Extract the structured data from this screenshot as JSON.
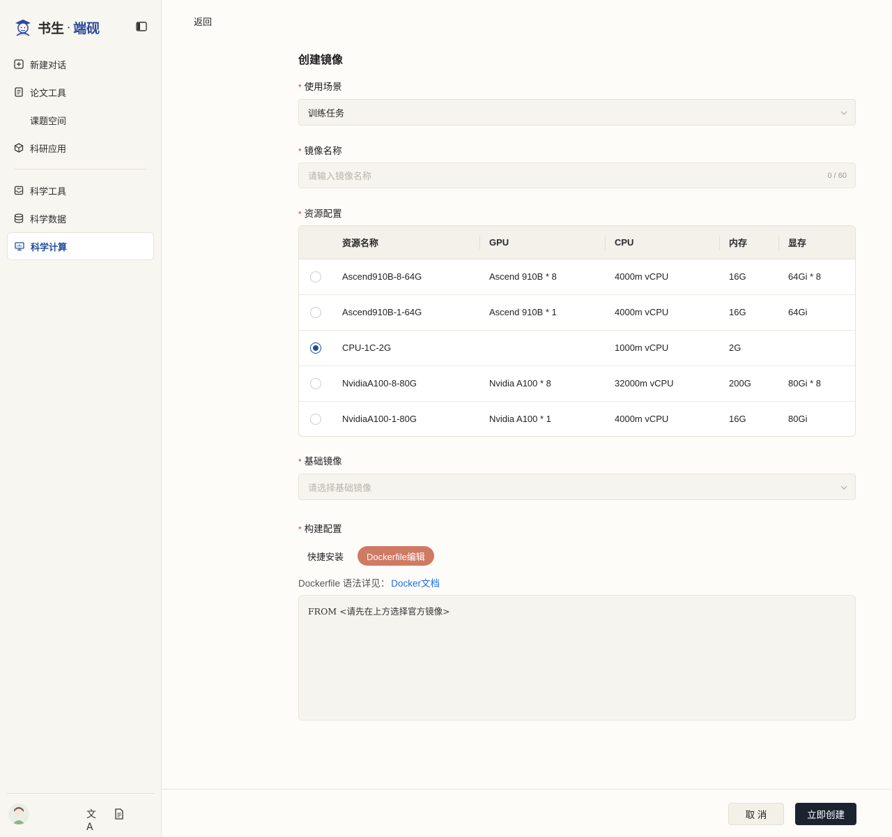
{
  "brand": {
    "name": "书生",
    "dot": "·",
    "accent": "端砚"
  },
  "sidebar": {
    "items": [
      {
        "label": "新建对话",
        "icon": "plus-square-icon"
      },
      {
        "label": "论文工具",
        "icon": "document-icon"
      },
      {
        "label": "课题空间",
        "icon": ""
      },
      {
        "label": "科研应用",
        "icon": "cube-icon"
      },
      {
        "label": "科学工具",
        "icon": "toolbox-icon"
      },
      {
        "label": "科学数据",
        "icon": "database-icon"
      },
      {
        "label": "科学计算",
        "icon": "monitor-icon",
        "active": true
      }
    ],
    "footer": {
      "translate_label": "文A"
    }
  },
  "header": {
    "back_label": "返回"
  },
  "form": {
    "title": "创建镜像",
    "required_mark": "*",
    "scenario": {
      "label": "使用场景",
      "value": "训练任务"
    },
    "image_name": {
      "label": "镜像名称",
      "placeholder": "请输入镜像名称",
      "count": "0 / 60"
    },
    "resources": {
      "label": "资源配置",
      "columns": [
        "资源名称",
        "GPU",
        "CPU",
        "内存",
        "显存"
      ],
      "rows": [
        {
          "name": "Ascend910B-8-64G",
          "gpu": "Ascend 910B * 8",
          "cpu": "4000m vCPU",
          "mem": "16G",
          "vram": "64Gi * 8",
          "selected": false
        },
        {
          "name": "Ascend910B-1-64G",
          "gpu": "Ascend 910B * 1",
          "cpu": "4000m vCPU",
          "mem": "16G",
          "vram": "64Gi",
          "selected": false
        },
        {
          "name": "CPU-1C-2G",
          "gpu": "",
          "cpu": "1000m vCPU",
          "mem": "2G",
          "vram": "",
          "selected": true
        },
        {
          "name": "NvidiaA100-8-80G",
          "gpu": "Nvidia A100 * 8",
          "cpu": "32000m vCPU",
          "mem": "200G",
          "vram": "80Gi * 8",
          "selected": false
        },
        {
          "name": "NvidiaA100-1-80G",
          "gpu": "Nvidia A100 * 1",
          "cpu": "4000m vCPU",
          "mem": "16G",
          "vram": "80Gi",
          "selected": false
        }
      ]
    },
    "base_image": {
      "label": "基础镜像",
      "placeholder": "请选择基础镜像"
    },
    "build": {
      "label": "构建配置",
      "tabs": [
        "快捷安装",
        "Dockerfile编辑"
      ],
      "active_tab": "Dockerfile编辑",
      "hint": "Dockerfile 语法详见：",
      "hint_link": "Docker文档",
      "dockerfile": "FROM <请先在上方选择官方镜像>"
    }
  },
  "actions": {
    "cancel_label": "取 消",
    "create_label": "立即创建"
  },
  "colors": {
    "accent": "#1f4d9a",
    "tab_active": "#cf7a62",
    "primary_button": "#1c2330",
    "required": "#d9363e"
  }
}
